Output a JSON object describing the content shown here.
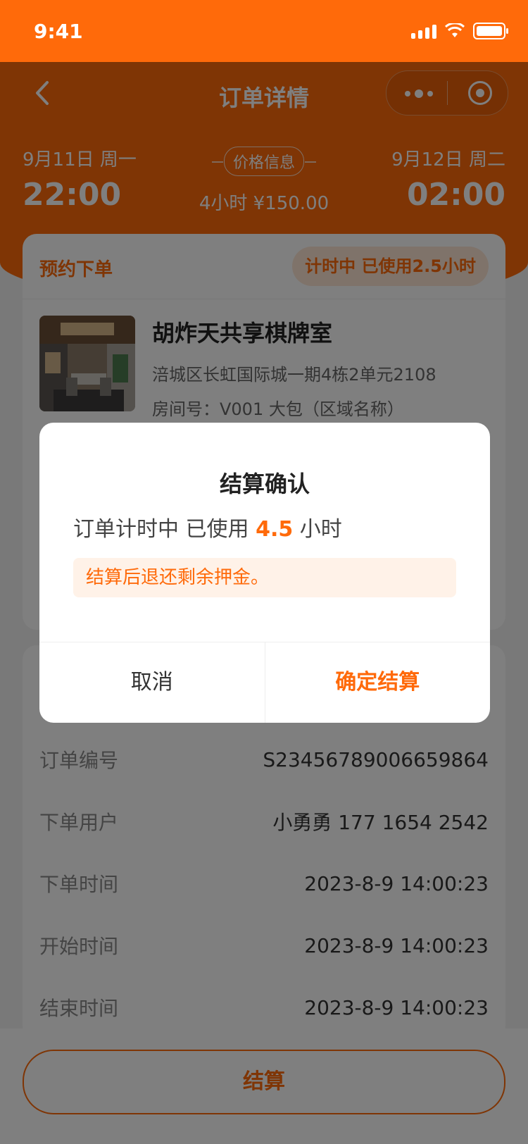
{
  "status_bar": {
    "time": "9:41"
  },
  "nav": {
    "title": "订单详情",
    "back_icon": "back-icon"
  },
  "header": {
    "start_date": "9月11日 周一",
    "start_time": "22:00",
    "price_tag": "价格信息",
    "duration_price": "4小时  ¥150.00",
    "end_date": "9月12日 周二",
    "end_time": "02:00"
  },
  "order_card": {
    "label": "预约下单",
    "status": "计时中  已使用2.5小时",
    "room": {
      "name": "胡炸天共享棋牌室",
      "address": "涪城区长虹国际城一期4栋2单元2108",
      "room_no": "房间号：V001 大包（区域名称）"
    }
  },
  "info": {
    "rows": [
      {
        "key": "订单编号",
        "value": "S23456789006659864"
      },
      {
        "key": "下单用户",
        "value": "小勇勇  177 1654 2542"
      },
      {
        "key": "下单时间",
        "value": "2023-8-9 14:00:23"
      },
      {
        "key": "开始时间",
        "value": "2023-8-9 14:00:23"
      },
      {
        "key": "结束时间",
        "value": "2023-8-9 14:00:23"
      }
    ]
  },
  "bottom": {
    "settle_label": "结算"
  },
  "dialog": {
    "title": "结算确认",
    "text_prefix": "订单计时中 已使用 ",
    "used_hours": "4.5",
    "text_suffix": " 小时",
    "tip": "结算后退还剩余押金。",
    "cancel": "取消",
    "confirm": "确定结算"
  },
  "colors": {
    "accent": "#ff6a0a",
    "tip_bg": "#fff2e8"
  }
}
